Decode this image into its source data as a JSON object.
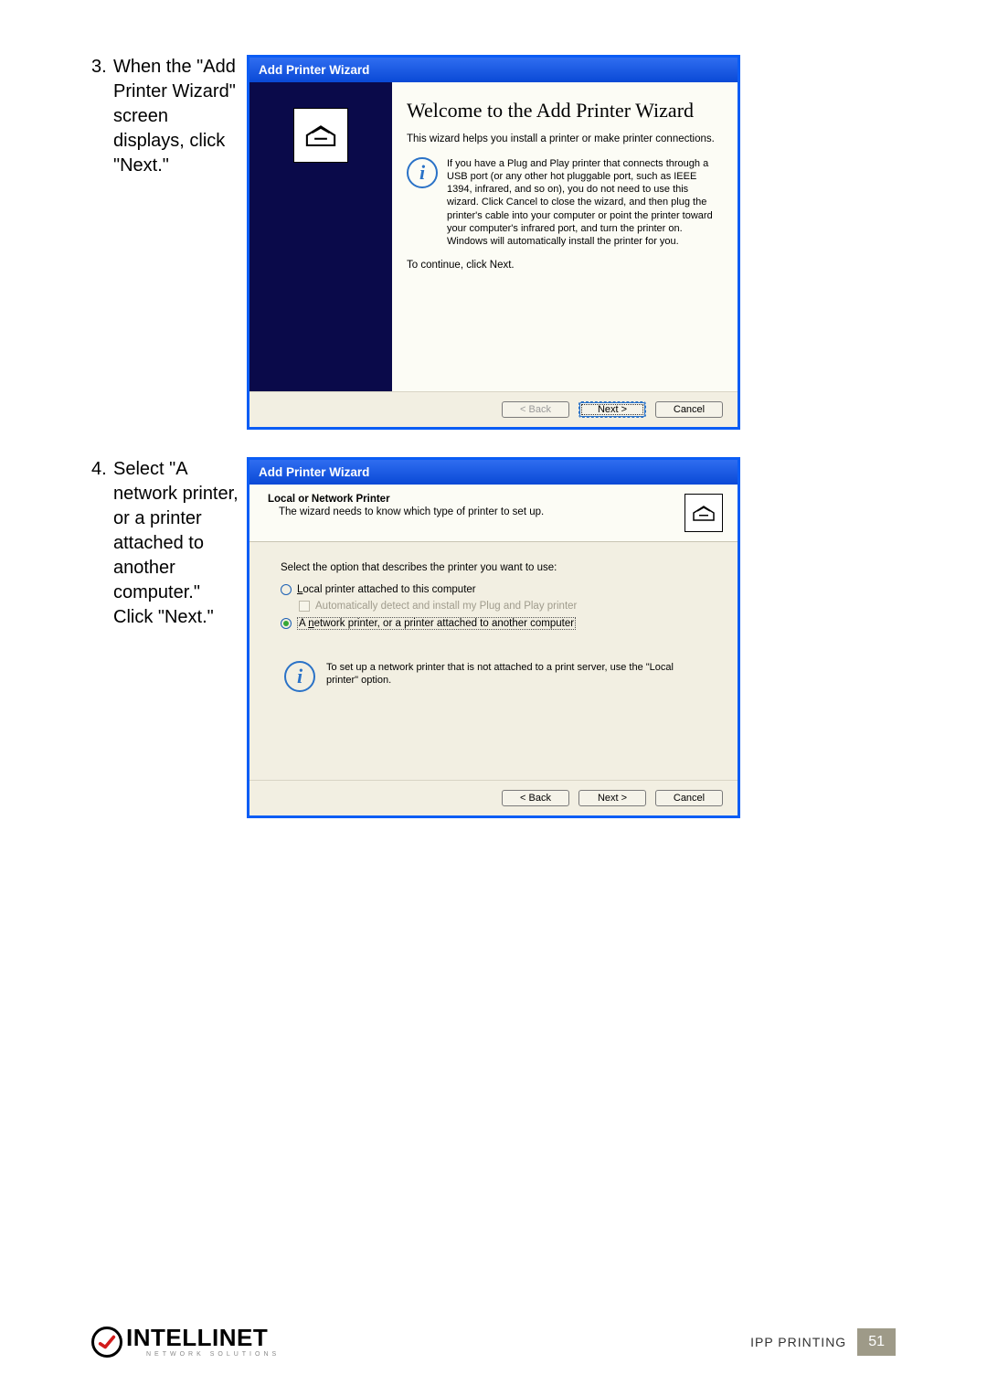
{
  "step3": {
    "number": "3.",
    "text": "When the \"Add Printer Wizard\" screen displays, click \"Next.\""
  },
  "step4": {
    "number": "4.",
    "text": "Select \"A network printer, or a printer attached to another computer.\" Click \"Next.\""
  },
  "wizard1": {
    "title": "Add Printer Wizard",
    "heading": "Welcome to the Add Printer Wizard",
    "intro": "This wizard helps you install a printer or make printer connections.",
    "info": "If you have a Plug and Play printer that connects through a USB port (or any other hot pluggable port, such as IEEE 1394, infrared, and so on), you do not need to use this wizard. Click Cancel to close the wizard, and then plug the printer's cable into your computer or point the printer toward your computer's infrared port, and turn the printer on. Windows will automatically install the printer for you.",
    "continue": "To continue, click Next.",
    "buttons": {
      "back": "< Back",
      "next": "Next >",
      "cancel": "Cancel"
    }
  },
  "wizard2": {
    "title": "Add Printer Wizard",
    "header_title": "Local or Network Printer",
    "header_sub": "The wizard needs to know which type of printer to set up.",
    "prompt": "Select the option that describes the printer you want to use:",
    "radio_local": "Local printer attached to this computer",
    "checkbox_auto": "Automatically detect and install my Plug and Play printer",
    "radio_network": "A network printer, or a printer attached to another computer",
    "info": "To set up a network printer that is not attached to a print server, use the \"Local printer\" option.",
    "buttons": {
      "back": "< Back",
      "next": "Next >",
      "cancel": "Cancel"
    }
  },
  "footer": {
    "brand_big": "INTELLINET",
    "brand_small": "NETWORK SOLUTIONS",
    "section": "IPP PRINTING",
    "page": "51"
  }
}
